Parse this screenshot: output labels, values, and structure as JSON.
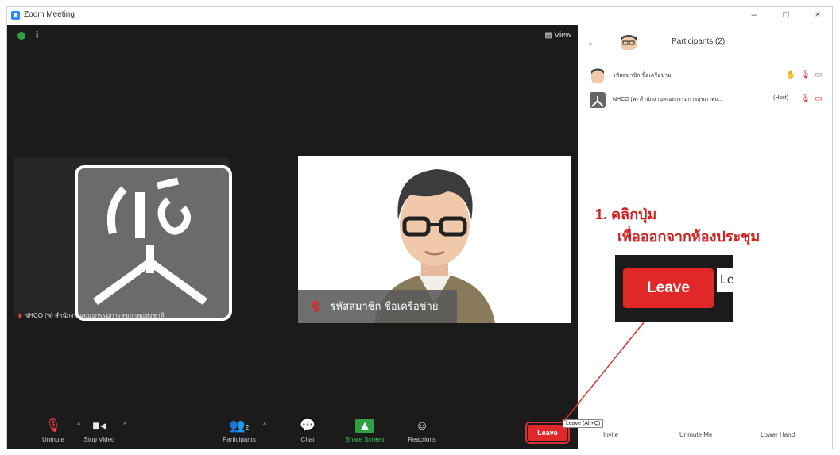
{
  "window": {
    "title": "Zoom Meeting",
    "controls": [
      "–",
      "□",
      "×"
    ]
  },
  "stage": {
    "info_symbol": "i",
    "view_label": "View"
  },
  "videos": {
    "left_name": "NHCO (พ) สำนักงานคณะกรรมการสุขภาพแห่งชาติ",
    "right_name": "รหัสสมาชิก ชื่อเครือข่าย"
  },
  "toolbar": {
    "unmute": "Unmute",
    "stop_video": "Stop Video",
    "participants": "Participants",
    "participants_count": "2",
    "chat": "Chat",
    "share_screen": "Share Screen",
    "reactions": "Reactions",
    "leave": "Leave",
    "leave_tooltip": "Leave (Alt+Q)"
  },
  "panel": {
    "title": "Participants (2)",
    "participants": [
      {
        "name": "รหัสสมาชิก ชื่อเครือข่าย",
        "tag": ""
      },
      {
        "name": "NHCO (พ) สำนักงานคณะกรรมการสุขภาพแ...",
        "tag": "(Host)"
      }
    ],
    "buttons": {
      "invite": "Invite",
      "unmute_me": "Unmute Me",
      "lower_hand": "Lower Hand"
    }
  },
  "annotation": {
    "line1": "1. คลิกปุ่ม",
    "line2": "เพื่อออกจากห้องประชุม",
    "zoom_leave": "Leave",
    "zoom_partial": "Le"
  },
  "colors": {
    "leave_red": "#e02828",
    "annotation_red": "#d32020",
    "share_green": "#2ea043",
    "zoom_blue": "#2d8cff"
  },
  "icons": {
    "mic_muted": "muted-microphone-icon",
    "video": "video-camera-icon",
    "participants": "people-icon",
    "chat": "chat-bubble-icon",
    "share": "share-screen-icon",
    "reactions": "smiley-icon",
    "hand": "raise-hand-icon"
  }
}
